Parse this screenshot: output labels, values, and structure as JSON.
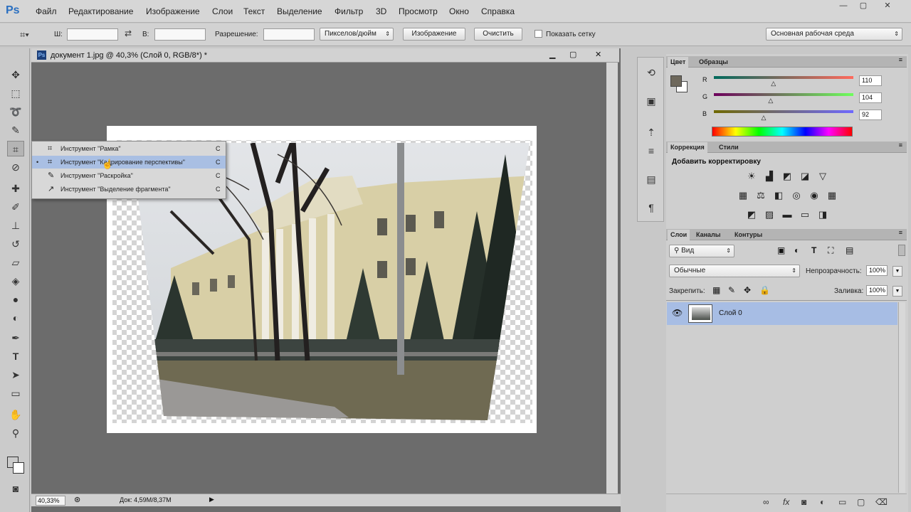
{
  "app": {
    "logo": "Ps"
  },
  "menu": [
    "Файл",
    "Редактирование",
    "Изображение",
    "Слои",
    "Текст",
    "Выделение",
    "Фильтр",
    "3D",
    "Просмотр",
    "Окно",
    "Справка"
  ],
  "window": {
    "minimize": "—",
    "restore": "▢",
    "close": "✕"
  },
  "options": {
    "w_label": "Ш:",
    "h_label": "В:",
    "resolution_label": "Разрешение:",
    "units": "Пикселов/дюйм",
    "image_btn": "Изображение",
    "clear_btn": "Очистить",
    "grid_label": "Показать сетку",
    "workspace": "Основная рабочая среда"
  },
  "document": {
    "title": "документ 1.jpg @ 40,3% (Слой 0, RGB/8*) *",
    "zoom": "40,33%",
    "doc_info": "Док: 4,59М/8,37М"
  },
  "flyout": [
    {
      "label": "Инструмент \"Рамка\"",
      "key": "C",
      "selected": false
    },
    {
      "label": "Инструмент \"Кадрирование перспективы\"",
      "key": "C",
      "selected": true
    },
    {
      "label": "Инструмент \"Раскройка\"",
      "key": "C",
      "selected": false
    },
    {
      "label": "Инструмент \"Выделение фрагмента\"",
      "key": "C",
      "selected": false
    }
  ],
  "color_panel": {
    "tabs": [
      "Цвет",
      "Образцы"
    ],
    "channels": [
      {
        "name": "R",
        "value": "110",
        "level": 0.43
      },
      {
        "name": "G",
        "value": "104",
        "level": 0.41
      },
      {
        "name": "B",
        "value": "92",
        "level": 0.36
      }
    ],
    "fg_color": "#6e685c",
    "bg_color": "#ffffff"
  },
  "adjust_panel": {
    "tabs": [
      "Коррекция",
      "Стили"
    ],
    "heading": "Добавить корректировку"
  },
  "layers_panel": {
    "tabs": [
      "Слои",
      "Каналы",
      "Контуры"
    ],
    "filter": "Вид",
    "blend_mode": "Обычные",
    "opacity_label": "Непрозрачность:",
    "opacity": "100%",
    "lock_label": "Закрепить:",
    "fill_label": "Заливка:",
    "fill": "100%",
    "layer_name": "Слой 0"
  },
  "colors": {
    "accent": "#a9bfe3",
    "doc_bg": "#6c6c6c"
  }
}
